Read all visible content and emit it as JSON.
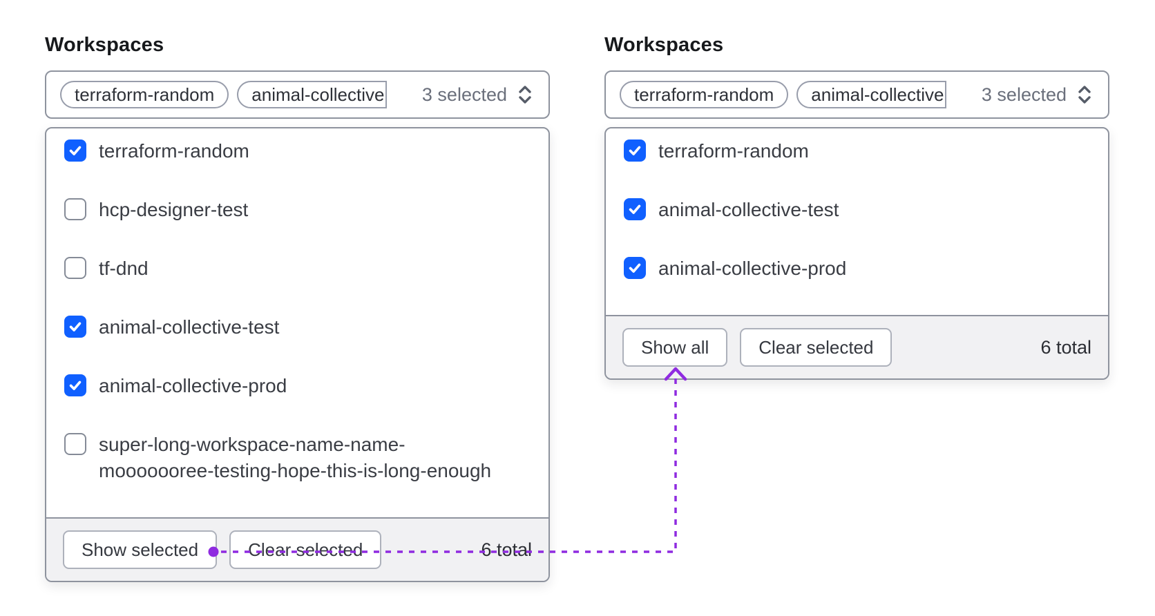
{
  "colors": {
    "checkbox_blue": "#1060ff",
    "annotation_purple": "#8f2be0"
  },
  "icons": {
    "trigger_caret": "chevron-up-down-icon",
    "checkbox_mark": "check-icon",
    "annotation": "arrow-connector-up"
  },
  "panels": [
    {
      "label": "Workspaces",
      "trigger": {
        "tags": [
          "terraform-random",
          "animal-collective"
        ],
        "summary": "3 selected"
      },
      "options": [
        {
          "label": "terraform-random",
          "checked": true
        },
        {
          "label": "hcp-designer-test",
          "checked": false
        },
        {
          "label": "tf-dnd",
          "checked": false
        },
        {
          "label": "animal-collective-test",
          "checked": true
        },
        {
          "label": "animal-collective-prod",
          "checked": true
        },
        {
          "label": "super-long-workspace-name-name-mooooooree-testing-hope-this-is-long-enough",
          "label_lines": [
            "super-long-workspace-name-name-",
            "mooooooree-testing-hope-this-is-long-enough"
          ],
          "checked": false
        }
      ],
      "footer": {
        "show_button": "Show selected",
        "clear_button": "Clear selected",
        "total": "6 total"
      }
    },
    {
      "label": "Workspaces",
      "trigger": {
        "tags": [
          "terraform-random",
          "animal-collective"
        ],
        "summary": "3 selected"
      },
      "options": [
        {
          "label": "terraform-random",
          "checked": true
        },
        {
          "label": "animal-collective-test",
          "checked": true
        },
        {
          "label": "animal-collective-prod",
          "checked": true
        }
      ],
      "footer": {
        "show_button": "Show all",
        "clear_button": "Clear selected",
        "total": "6 total"
      }
    }
  ]
}
